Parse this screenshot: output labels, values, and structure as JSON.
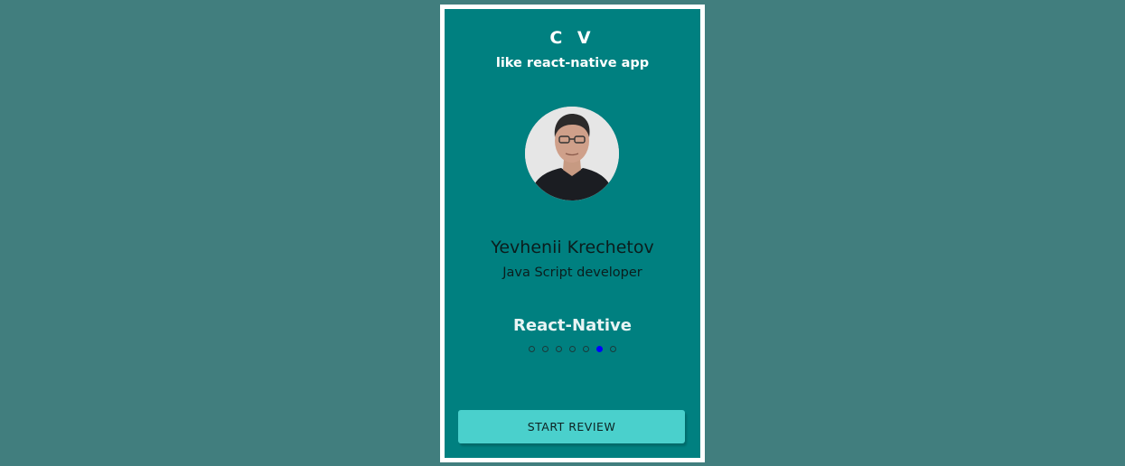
{
  "header": {
    "title": "C V",
    "subtitle": "like react-native app"
  },
  "profile": {
    "name": "Yevhenii Krechetov",
    "role": "Java Script developer"
  },
  "skills": {
    "current": "React-Native",
    "total_slides": 7,
    "active_index": 5
  },
  "actions": {
    "start_label": "START REVIEW"
  },
  "colors": {
    "page_background": "#417e7e",
    "app_background": "#008080",
    "button": "#4ad0cc",
    "active_dot": "#0000ff"
  }
}
